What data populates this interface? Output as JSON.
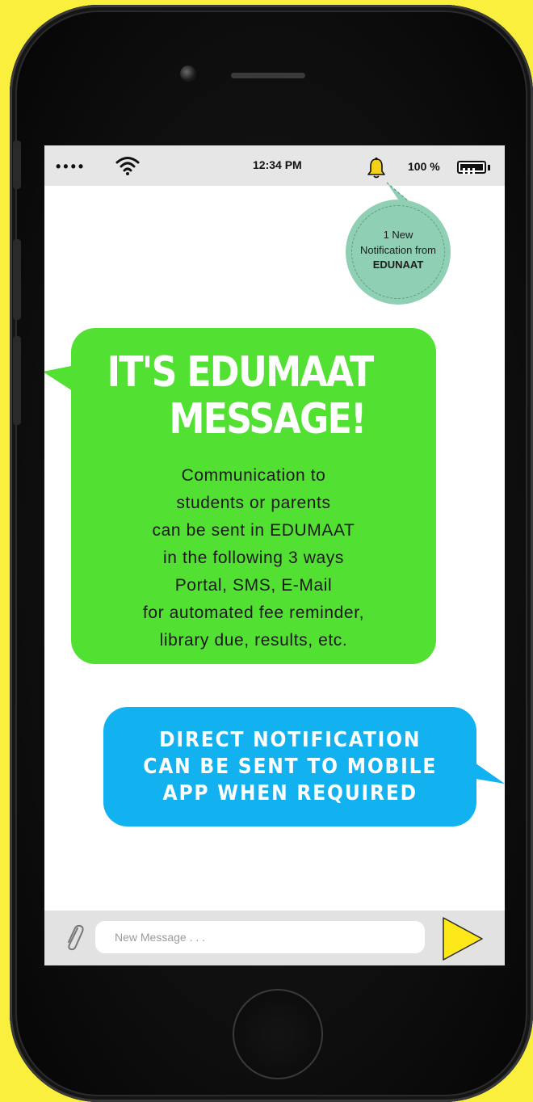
{
  "status_bar": {
    "signal": "••••",
    "time": "12:34 PM",
    "battery": "100 %",
    "wifi_icon": "wifi-icon",
    "bell_icon": "bell-icon"
  },
  "notification": {
    "line1": "1 New",
    "line2": "Notification from",
    "line3": "EDUNAAT"
  },
  "green_message": {
    "headline_line1": "IT'S  EDUMAAT",
    "headline_line2": "MESSAGE!",
    "body_lines": [
      "Communication to",
      "students or parents",
      "can be sent in EDUMAAT",
      "in the following 3 ways",
      "Portal, SMS, E-Mail",
      "for automated  fee reminder,",
      "library due, results, etc."
    ],
    "color": "#52e033"
  },
  "blue_message": {
    "lines": [
      "DIRECT NOTIFICATION",
      "CAN BE SENT TO MOBILE",
      "APP WHEN REQUIRED"
    ],
    "color": "#12b1f0"
  },
  "composer": {
    "placeholder": "New Message . . .",
    "attach_icon": "paperclip-icon",
    "send_icon": "send-icon"
  },
  "colors": {
    "background": "#fbef3e",
    "send_button": "#ffe81a",
    "notification_bubble": "#8fcfb4"
  }
}
